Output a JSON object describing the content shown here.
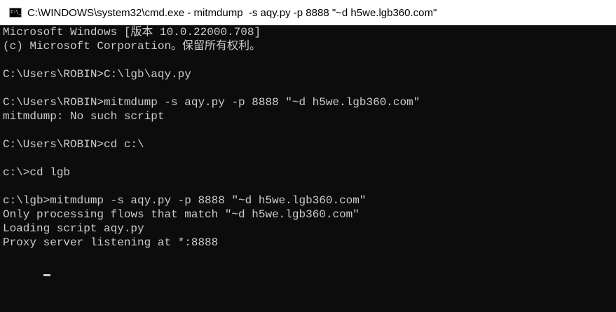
{
  "window": {
    "title": "C:\\WINDOWS\\system32\\cmd.exe - mitmdump  -s aqy.py -p 8888 \"~d h5we.lgb360.com\"",
    "icon": "cmd-icon",
    "icon_glyph": "C:\\_"
  },
  "console": {
    "lines": [
      "Microsoft Windows [版本 10.0.22000.708]",
      "(c) Microsoft Corporation。保留所有权利。",
      "",
      "C:\\Users\\ROBIN>C:\\lgb\\aqy.py",
      "",
      "C:\\Users\\ROBIN>mitmdump -s aqy.py -p 8888 \"~d h5we.lgb360.com\"",
      "mitmdump: No such script",
      "",
      "C:\\Users\\ROBIN>cd c:\\",
      "",
      "c:\\>cd lgb",
      "",
      "c:\\lgb>mitmdump -s aqy.py -p 8888 \"~d h5we.lgb360.com\"",
      "Only processing flows that match \"~d h5we.lgb360.com\"",
      "Loading script aqy.py",
      "Proxy server listening at *:8888",
      ""
    ]
  },
  "colors": {
    "console_bg": "#0c0c0c",
    "console_fg": "#cccccc",
    "titlebar_bg": "#ffffff"
  }
}
